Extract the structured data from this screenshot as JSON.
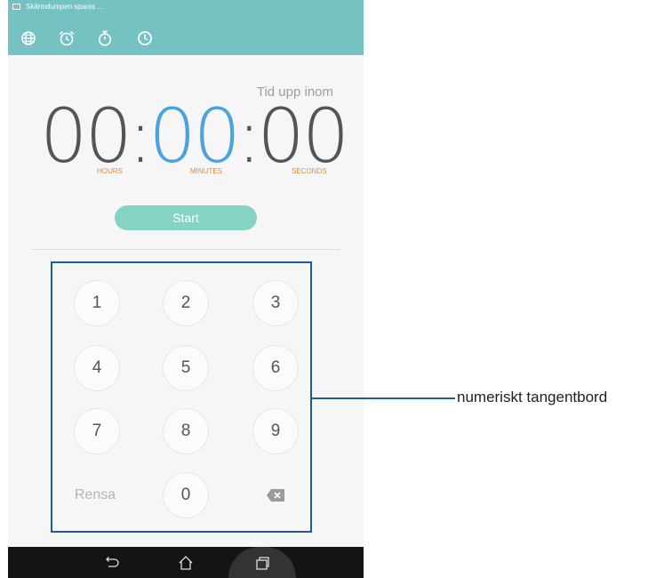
{
  "status_bar": {
    "notification_text": "Skärmdumpen sparas ..."
  },
  "toolbar": {
    "icons": [
      "globe-icon",
      "alarm-icon",
      "stopwatch-icon",
      "timer-icon"
    ]
  },
  "timer": {
    "label": "Tid upp inom",
    "hours": "00",
    "minutes": "00",
    "seconds": "00",
    "separator": ":",
    "units": {
      "hours": "HOURS",
      "minutes": "MINUTES",
      "seconds": "SECONDS"
    },
    "start_label": "Start"
  },
  "keypad": {
    "keys": [
      "1",
      "2",
      "3",
      "4",
      "5",
      "6",
      "7",
      "8",
      "9"
    ],
    "clear_label": "Rensa",
    "zero": "0",
    "backspace_icon": "backspace-icon"
  },
  "nav_bar": {
    "icons": [
      "back-icon",
      "home-icon",
      "recent-apps-icon"
    ]
  },
  "annotation": {
    "callout": "numeriskt tangentbord"
  },
  "colors": {
    "header": "#74c2c2",
    "minutes_digits": "#4aa3df",
    "units": "#f0882d",
    "start_button": "#86d3c4",
    "annotation": "#1d5aa5"
  }
}
